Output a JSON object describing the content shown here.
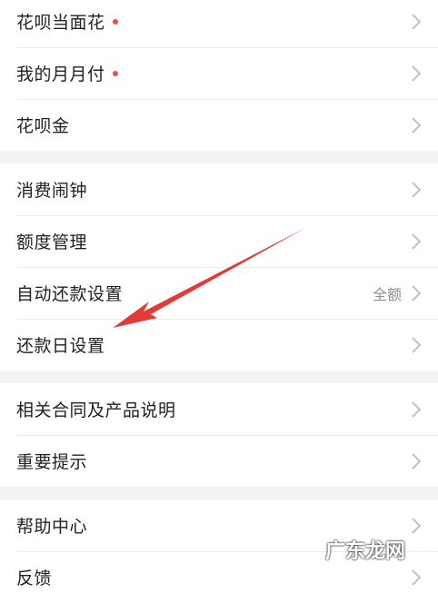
{
  "groups": [
    [
      {
        "label": "花呗当面花",
        "dot": true
      },
      {
        "label": "我的月月付",
        "dot": true
      },
      {
        "label": "花呗金"
      }
    ],
    [
      {
        "label": "消费闹钟"
      },
      {
        "label": "额度管理"
      },
      {
        "label": "自动还款设置",
        "value": "全额"
      },
      {
        "label": "还款日设置"
      }
    ],
    [
      {
        "label": "相关合同及产品说明"
      },
      {
        "label": "重要提示"
      }
    ],
    [
      {
        "label": "帮助中心"
      },
      {
        "label": "反馈"
      }
    ]
  ],
  "watermark": "广东龙网",
  "colors": {
    "dot": "#e2534f",
    "arrow": "#e23b36",
    "chevron": "#c2c2c2"
  },
  "icons": {
    "chevron": "chevron-right-icon",
    "arrow": "annotation-arrow-icon"
  }
}
